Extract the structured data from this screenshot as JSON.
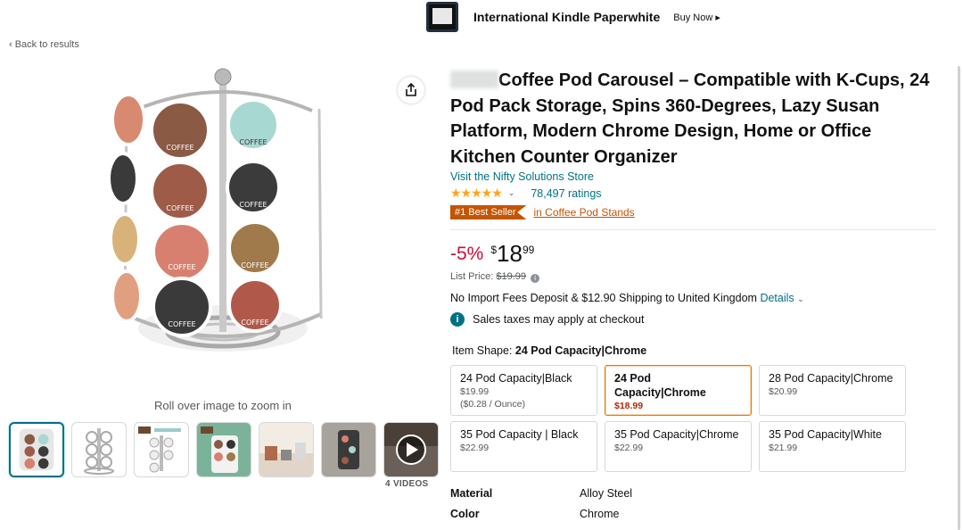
{
  "banner": {
    "title": "International Kindle Paperwhite",
    "cta": "Buy Now ▸"
  },
  "nav": {
    "back": "‹ Back to results"
  },
  "gallery": {
    "zoom_hint": "Roll over image to zoom in",
    "videos_label": "4 VIDEOS"
  },
  "product": {
    "title": "Coffee Pod Carousel – Compatible with K-Cups, 24 Pod Pack Storage, Spins 360-Degrees, Lazy Susan Platform, Modern Chrome Design, Home or Office Kitchen Counter Organizer",
    "store_link": "Visit the Nifty Solutions Store",
    "stars": "★★★★★",
    "rating_count": "78,497 ratings",
    "best_seller_badge": "#1 Best Seller",
    "best_seller_category": "in Coffee Pod Stands"
  },
  "price": {
    "discount": "-5%",
    "currency": "$",
    "whole": "18",
    "fraction": "99",
    "list_price_label": "List Price:",
    "list_price": "$19.99",
    "shipping_text": "No Import Fees Deposit & $12.90 Shipping to United Kingdom",
    "details_link": "Details",
    "tax_note": "Sales taxes may apply at checkout"
  },
  "item_shape": {
    "label": "Item Shape:",
    "selected": "24 Pod Capacity|Chrome",
    "options": [
      {
        "name": "24 Pod Capacity|Black",
        "price": "$19.99",
        "unit_price": "($0.28 / Ounce)"
      },
      {
        "name": "24 Pod Capacity|Chrome",
        "price": "$18.99"
      },
      {
        "name": "28 Pod Capacity|Chrome",
        "price": "$20.99"
      },
      {
        "name": "35 Pod Capacity | Black",
        "price": "$22.99"
      },
      {
        "name": "35 Pod Capacity|Chrome",
        "price": "$22.99"
      },
      {
        "name": "35 Pod Capacity|White",
        "price": "$21.99"
      }
    ]
  },
  "specs": [
    {
      "key": "Material",
      "value": "Alloy Steel"
    },
    {
      "key": "Color",
      "value": "Chrome"
    }
  ],
  "colors": {
    "link": "#007185",
    "deal_red": "#cc0c39",
    "best_seller": "#c45500",
    "star": "#ffa41c",
    "selected_border": "#e77600"
  }
}
